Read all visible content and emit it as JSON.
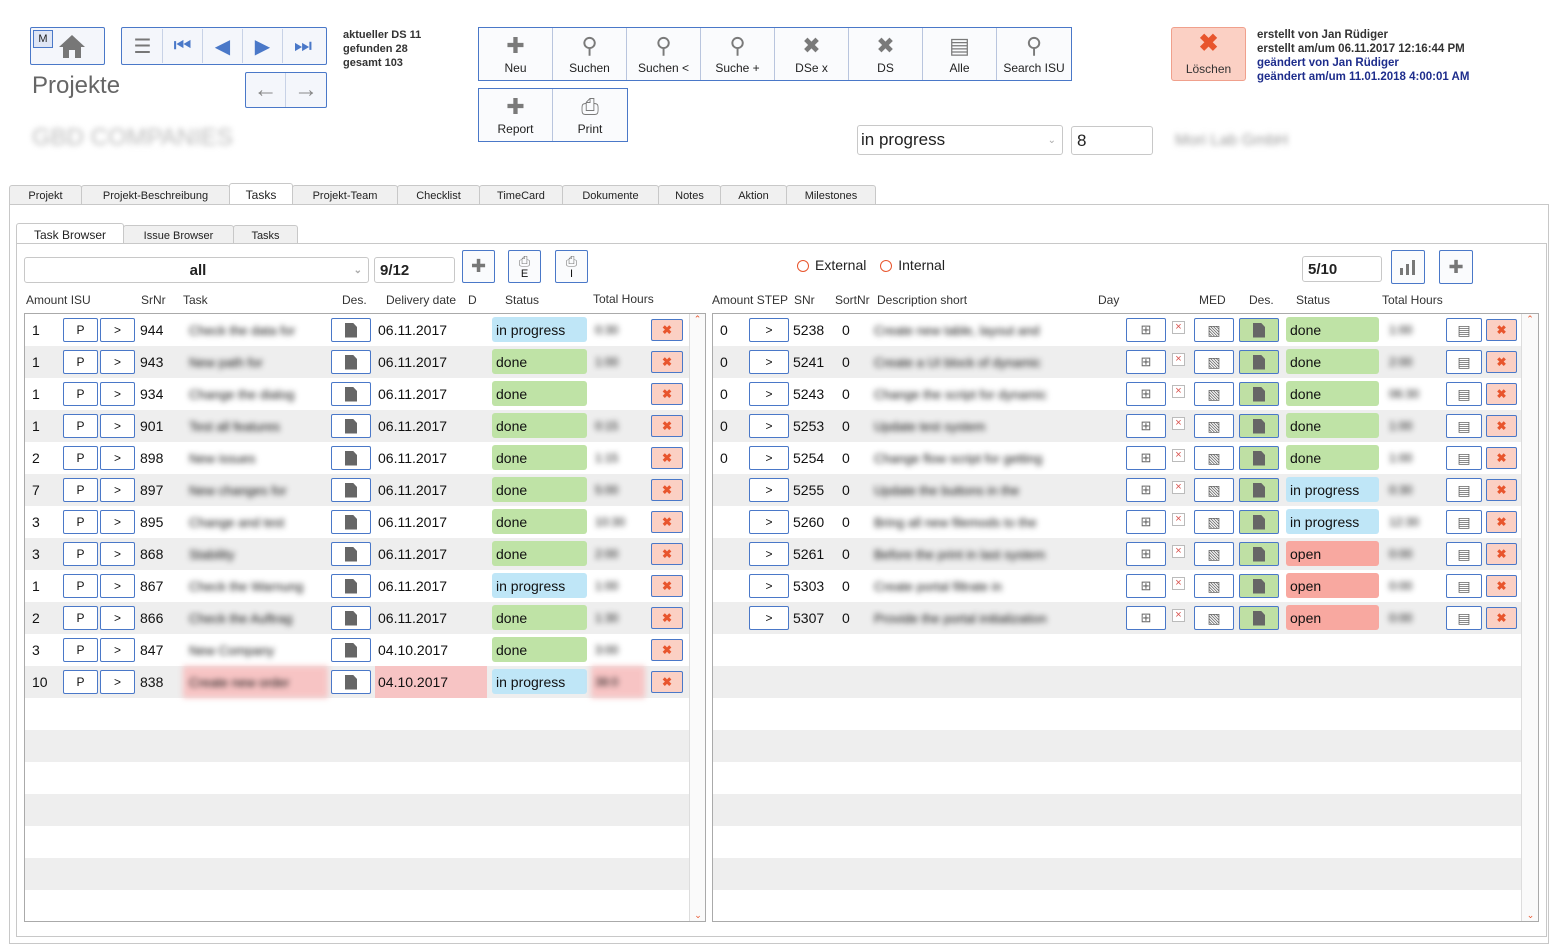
{
  "header": {
    "m_badge": "M",
    "info": {
      "line1": "aktueller DS 11",
      "line2": "gefunden 28",
      "line3": "gesamt 103"
    },
    "title": "Projekte",
    "company_blurred": "GBD COMPANIES",
    "right_blurred": "Mori Lab GmbH",
    "status_select": "in progress",
    "number_field": "8",
    "meta": {
      "created_by": "erstellt von Jan Rüdiger",
      "created_at": "erstellt am/um 06.11.2017 12:16:44 PM",
      "changed_by": "geändert von Jan Rüdiger",
      "changed_at": "geändert am/um 11.01.2018 4:00:01 AM"
    },
    "delete_label": "Löschen"
  },
  "toolbar": {
    "buttons": [
      "Neu",
      "Suchen",
      "Suchen <",
      "Suche +",
      "DSe x",
      "DS",
      "Alle",
      "Search ISU"
    ],
    "buttons2": [
      "Report",
      "Print"
    ]
  },
  "main_tabs": [
    "Projekt",
    "Projekt-Beschreibung",
    "Tasks",
    "Projekt-Team",
    "Checklist",
    "TimeCard",
    "Dokumente",
    "Notes",
    "Aktion",
    "Milestones"
  ],
  "sub_tabs": [
    "Task Browser",
    "Issue Browser",
    "Tasks"
  ],
  "left": {
    "filter": "all",
    "counter": "9/12",
    "btn_e": "E",
    "btn_i": "I",
    "columns": [
      "Amount ISU",
      "SrNr",
      "Task",
      "Des.",
      "Delivery date",
      "D",
      "Status",
      "Total Hours"
    ],
    "p_label": "P",
    "go_label": ">",
    "rows": [
      {
        "amount": "1",
        "srnr": "944",
        "task": "Check the data for",
        "date": "06.11.2017",
        "status": "in progress",
        "hours": "0:30"
      },
      {
        "amount": "1",
        "srnr": "943",
        "task": "New path for",
        "date": "06.11.2017",
        "status": "done",
        "hours": "1:00"
      },
      {
        "amount": "1",
        "srnr": "934",
        "task": "Change the dialog",
        "date": "06.11.2017",
        "status": "done",
        "hours": ""
      },
      {
        "amount": "1",
        "srnr": "901",
        "task": "Test all features",
        "date": "06.11.2017",
        "status": "done",
        "hours": "0:15"
      },
      {
        "amount": "2",
        "srnr": "898",
        "task": "New issues",
        "date": "06.11.2017",
        "status": "done",
        "hours": "1:15"
      },
      {
        "amount": "7",
        "srnr": "897",
        "task": "New changes for",
        "date": "06.11.2017",
        "status": "done",
        "hours": "5:00"
      },
      {
        "amount": "3",
        "srnr": "895",
        "task": "Change and test",
        "date": "06.11.2017",
        "status": "done",
        "hours": "10:30"
      },
      {
        "amount": "3",
        "srnr": "868",
        "task": "Stability",
        "date": "06.11.2017",
        "status": "done",
        "hours": "2:00"
      },
      {
        "amount": "1",
        "srnr": "867",
        "task": "Check the Warnung",
        "date": "06.11.2017",
        "status": "in progress",
        "hours": "1:00"
      },
      {
        "amount": "2",
        "srnr": "866",
        "task": "Check the Auftrag",
        "date": "06.11.2017",
        "status": "done",
        "hours": "1:30"
      },
      {
        "amount": "3",
        "srnr": "847",
        "task": "New Company",
        "date": "04.10.2017",
        "status": "done",
        "hours": "3:00"
      },
      {
        "amount": "10",
        "srnr": "838",
        "task": "Create new order",
        "date": "04.10.2017",
        "status": "in progress",
        "hours": "38:0",
        "highlight": true
      }
    ]
  },
  "right": {
    "radio_external": "External",
    "radio_internal": "Internal",
    "counter": "5/10",
    "columns": [
      "Amount STEP",
      "SNr",
      "SortNr",
      "Description short",
      "Day",
      "MED",
      "Des.",
      "Status",
      "Total Hours"
    ],
    "go_label": ">",
    "rows": [
      {
        "amount": "0",
        "snr": "5238",
        "sort": "0",
        "desc": "Create new table, layout and",
        "status": "done",
        "hours": "1:00"
      },
      {
        "amount": "0",
        "snr": "5241",
        "sort": "0",
        "desc": "Create a UI block of dynamic",
        "status": "done",
        "hours": "2:00"
      },
      {
        "amount": "0",
        "snr": "5243",
        "sort": "0",
        "desc": "Change the script for dynamic",
        "status": "done",
        "hours": "06:30"
      },
      {
        "amount": "0",
        "snr": "5253",
        "sort": "0",
        "desc": "Update test system",
        "status": "done",
        "hours": "1:00"
      },
      {
        "amount": "0",
        "snr": "5254",
        "sort": "0",
        "desc": "Change flow script for getting",
        "status": "done",
        "hours": "1:00"
      },
      {
        "amount": "",
        "snr": "5255",
        "sort": "0",
        "desc": "Update the buttons in the",
        "status": "in progress",
        "hours": "0:30"
      },
      {
        "amount": "",
        "snr": "5260",
        "sort": "0",
        "desc": "Bring all new filemods to the",
        "status": "in progress",
        "hours": "12:30"
      },
      {
        "amount": "",
        "snr": "5261",
        "sort": "0",
        "desc": "Before the print in last system",
        "status": "open",
        "hours": "0:00"
      },
      {
        "amount": "",
        "snr": "5303",
        "sort": "0",
        "desc": "Create portal filtrate in",
        "status": "open",
        "hours": "0:00"
      },
      {
        "amount": "",
        "snr": "5307",
        "sort": "0",
        "desc": "Provide the portal initialization",
        "status": "open",
        "hours": "0:00"
      }
    ]
  }
}
